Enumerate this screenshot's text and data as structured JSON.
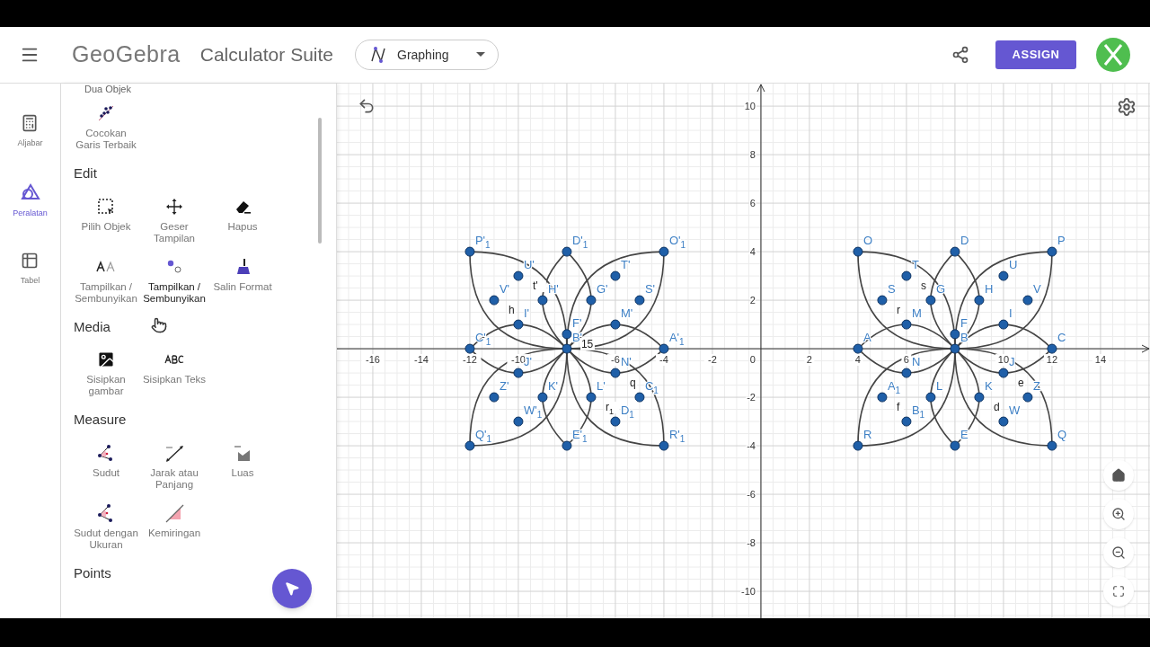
{
  "header": {
    "app_name": "GeoGebra",
    "suite": "Calculator Suite",
    "app_switch": "Graphing",
    "assign": "ASSIGN"
  },
  "rail": [
    {
      "label": "Aljabar",
      "kind": "algebra",
      "selected": false
    },
    {
      "label": "Peralatan",
      "kind": "tools",
      "selected": true
    },
    {
      "label": "Tabel",
      "kind": "table",
      "selected": false
    }
  ],
  "tools_panel": {
    "top_cut_label": "Dua Objek",
    "sections": [
      {
        "tools": [
          {
            "label": "Cocokan Garis Terbaik",
            "kind": "fit-line",
            "hovered": false
          }
        ]
      },
      {
        "title": "Edit",
        "tools": [
          {
            "label": "Pilih Objek",
            "kind": "select",
            "hovered": false
          },
          {
            "label": "Geser Tampilan",
            "kind": "move-view",
            "hovered": false
          },
          {
            "label": "Hapus",
            "kind": "erase",
            "hovered": false
          },
          {
            "label": "Tampilkan / Sembunyikan",
            "kind": "show-label",
            "hovered": false
          },
          {
            "label": "Tampilkan / Sembunyikan",
            "kind": "show-object",
            "hovered": true
          },
          {
            "label": "Salin Format",
            "kind": "copy-style",
            "hovered": false
          }
        ]
      },
      {
        "title": "Media",
        "tools": [
          {
            "label": "Sisipkan gambar",
            "kind": "image",
            "hovered": false
          },
          {
            "label": "Sisipkan Teks",
            "kind": "text",
            "hovered": false
          }
        ]
      },
      {
        "title": "Measure",
        "tools": [
          {
            "label": "Sudut",
            "kind": "angle",
            "hovered": false
          },
          {
            "label": "Jarak atau Panjang",
            "kind": "distance",
            "hovered": false
          },
          {
            "label": "Luas",
            "kind": "area",
            "hovered": false
          },
          {
            "label": "Sudut dengan Ukuran",
            "kind": "angle-size",
            "hovered": false
          },
          {
            "label": "Kemiringan",
            "kind": "slope",
            "hovered": false
          }
        ]
      },
      {
        "title": "Points"
      }
    ]
  },
  "graph": {
    "origin_label": "0",
    "chart_data": {
      "type": "scatter",
      "grid": true,
      "xlim": [
        -17.48,
        16.04
      ],
      "ylim": [
        -11.11,
        10.93
      ],
      "xticks": [
        -16,
        -14,
        -12,
        -10,
        -6,
        -4,
        -2,
        2,
        4,
        6,
        10,
        12,
        14
      ],
      "yticks": [
        -10,
        -8,
        -6,
        -4,
        -2,
        2,
        4,
        6,
        8,
        10
      ],
      "x": [
        4,
        8,
        12,
        6,
        10,
        5,
        7,
        9,
        11,
        6,
        10,
        8,
        8,
        4,
        12,
        6,
        10,
        5,
        7,
        9,
        11,
        6,
        10,
        4,
        8,
        12,
        -12,
        -8,
        -4,
        -10,
        -6,
        -11,
        -9,
        -7,
        -5,
        -10,
        -6,
        -8,
        -8,
        -12,
        -4,
        -10,
        -6,
        -11,
        -9,
        -7,
        -5,
        -10,
        -6,
        -12,
        -8,
        -4
      ],
      "series": [
        {
          "color": "#1f5fa8",
          "values": [
            4,
            4,
            4,
            3,
            3,
            2,
            2,
            2,
            2,
            1,
            1,
            0.6,
            0,
            0,
            0,
            -1,
            -1,
            -2,
            -2,
            -2,
            -2,
            -3,
            -3,
            -4,
            -4,
            -4,
            4,
            4,
            4,
            3,
            3,
            2,
            2,
            2,
            2,
            1,
            1,
            0.6,
            0,
            0,
            0,
            -1,
            -1,
            -2,
            -2,
            -2,
            -2,
            -3,
            -3,
            -4,
            -4,
            -4
          ]
        }
      ],
      "annotations": [
        {
          "x": 4,
          "y": 4,
          "text": "O"
        },
        {
          "x": 8,
          "y": 4,
          "text": "D"
        },
        {
          "x": 12,
          "y": 4,
          "text": "P"
        },
        {
          "x": 6,
          "y": 3,
          "text": "T"
        },
        {
          "x": 10,
          "y": 3,
          "text": "U"
        },
        {
          "x": 5,
          "y": 2,
          "text": "S"
        },
        {
          "x": 7,
          "y": 2,
          "text": "G"
        },
        {
          "x": 9,
          "y": 2,
          "text": "H"
        },
        {
          "x": 11,
          "y": 2,
          "text": "V"
        },
        {
          "x": 6,
          "y": 1,
          "text": "M"
        },
        {
          "x": 10,
          "y": 1,
          "text": "I"
        },
        {
          "x": 8,
          "y": 0.6,
          "text": "F"
        },
        {
          "x": 8,
          "y": 0,
          "text": "B"
        },
        {
          "x": 4,
          "y": 0,
          "text": "A"
        },
        {
          "x": 12,
          "y": 0,
          "text": "C"
        },
        {
          "x": 6,
          "y": -1,
          "text": "N"
        },
        {
          "x": 10,
          "y": -1,
          "text": "J"
        },
        {
          "x": 5,
          "y": -2,
          "text": "A$_{1}$"
        },
        {
          "x": 7,
          "y": -2,
          "text": "L"
        },
        {
          "x": 9,
          "y": -2,
          "text": "K"
        },
        {
          "x": 11,
          "y": -2,
          "text": "Z"
        },
        {
          "x": 6,
          "y": -3,
          "text": "B$_{1}$"
        },
        {
          "x": 10,
          "y": -3,
          "text": "W"
        },
        {
          "x": 4,
          "y": -4,
          "text": "R"
        },
        {
          "x": 8,
          "y": -4,
          "text": "E"
        },
        {
          "x": 12,
          "y": -4,
          "text": "Q"
        },
        {
          "x": -12,
          "y": 4,
          "text": "P'$_{1}$"
        },
        {
          "x": -8,
          "y": 4,
          "text": "D'$_{1}$"
        },
        {
          "x": -4,
          "y": 4,
          "text": "O'$_{1}$"
        },
        {
          "x": -10,
          "y": 3,
          "text": "U'"
        },
        {
          "x": -6,
          "y": 3,
          "text": "T'"
        },
        {
          "x": -11,
          "y": 2,
          "text": "V'"
        },
        {
          "x": -9,
          "y": 2,
          "text": "H'"
        },
        {
          "x": -7,
          "y": 2,
          "text": "G'"
        },
        {
          "x": -5,
          "y": 2,
          "text": "S'"
        },
        {
          "x": -10,
          "y": 1,
          "text": "I'"
        },
        {
          "x": -6,
          "y": 1,
          "text": "M'"
        },
        {
          "x": -8,
          "y": 0.6,
          "text": "F'"
        },
        {
          "x": -8,
          "y": 0,
          "text": "B'"
        },
        {
          "x": -12,
          "y": 0,
          "text": "C'$_{1}$"
        },
        {
          "x": -4,
          "y": 0,
          "text": "A'$_{1}$"
        },
        {
          "x": -10,
          "y": -1,
          "text": "J'"
        },
        {
          "x": -6,
          "y": -1,
          "text": "N'"
        },
        {
          "x": -11,
          "y": -2,
          "text": "Z'"
        },
        {
          "x": -9,
          "y": -2,
          "text": "K'"
        },
        {
          "x": -7,
          "y": -2,
          "text": "L'"
        },
        {
          "x": -5,
          "y": -2,
          "text": "C$_{1}$"
        },
        {
          "x": -10,
          "y": -3,
          "text": "W'$_{1}$"
        },
        {
          "x": -6,
          "y": -3,
          "text": "D$_{1}$"
        },
        {
          "x": -12,
          "y": -4,
          "text": "Q'$_{1}$"
        },
        {
          "x": -8,
          "y": -4,
          "text": "E'$_{1}$"
        },
        {
          "x": -4,
          "y": -4,
          "text": "R'$_{1}$"
        },
        {
          "x": 6,
          "y": 3,
          "text": "s"
        },
        {
          "x": 5,
          "y": 2,
          "text": "r"
        },
        {
          "x": 9,
          "y": -2,
          "text": "d"
        },
        {
          "x": 10,
          "y": -1,
          "text": "e"
        },
        {
          "x": 5,
          "y": -2,
          "text": "f"
        },
        {
          "x": -10,
          "y": 3,
          "text": "t'"
        },
        {
          "x": -11,
          "y": 2,
          "text": "h"
        },
        {
          "x": -6,
          "y": -1,
          "text": "q"
        },
        {
          "x": -7,
          "y": -2,
          "text": "r$_{1}$"
        },
        {
          "x": -8,
          "y": 0.6,
          "text": "15"
        }
      ]
    }
  }
}
